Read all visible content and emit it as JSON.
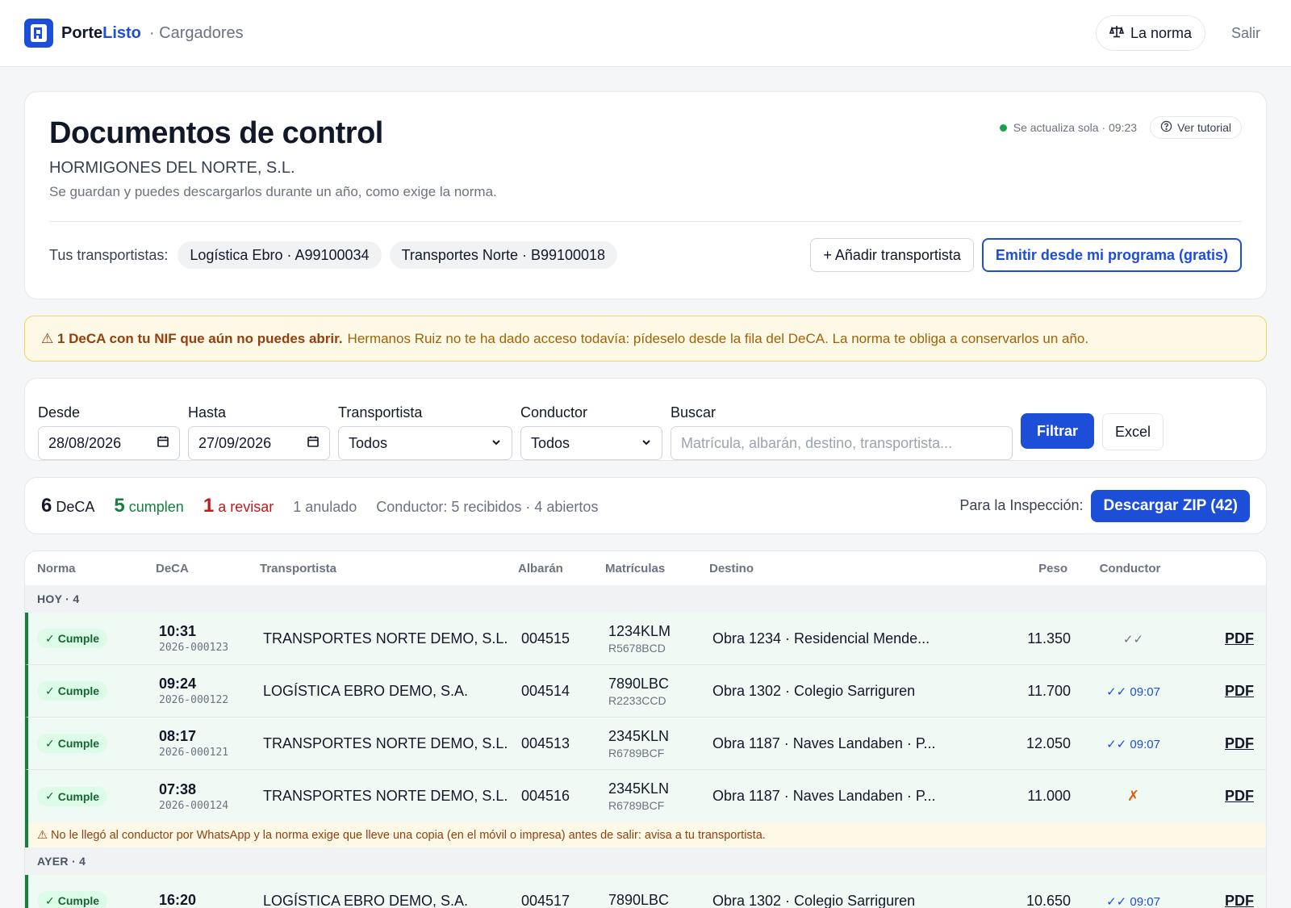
{
  "app": {
    "brand_part1": "Porte",
    "brand_part2": "Listo",
    "brand_sub": "· Cargadores",
    "norma_label": "La norma",
    "logout_label": "Salir"
  },
  "header": {
    "title": "Documentos de control",
    "company": "HORMIGONES DEL NORTE, S.L.",
    "note": "Se guardan y puedes descargarlos durante un año, como exige la norma.",
    "live_status": "Se actualiza sola · 09:23",
    "tutorial_label": "Ver tutorial",
    "carriers_label": "Tus transportistas:",
    "carriers": [
      "Logística Ebro · A99100034",
      "Transportes Norte · B99100018"
    ],
    "add_carrier_label": "+ Añadir transportista",
    "emit_label": "Emitir desde mi programa (gratis)"
  },
  "alert": {
    "strong": "⚠ 1 DeCA con tu NIF que aún no puedes abrir.",
    "rest": "Hermanos Ruiz no te ha dado acceso todavía: pídeselo desde la fila del DeCA. La norma te obliga a conservarlos un año."
  },
  "filters": {
    "desde_label": "Desde",
    "desde_value": "28/08/2026",
    "hasta_label": "Hasta",
    "hasta_value": "27/09/2026",
    "transportista_label": "Transportista",
    "transportista_value": "Todos",
    "conductor_label": "Conductor",
    "conductor_value": "Todos",
    "buscar_label": "Buscar",
    "buscar_placeholder": "Matrícula, albarán, destino, transportista...",
    "filter_button": "Filtrar",
    "excel_button": "Excel"
  },
  "summary": {
    "total_num": "6",
    "total_label": "DeCA",
    "ok_num": "5",
    "ok_label": "cumplen",
    "review_num": "1",
    "review_label": "a revisar",
    "annulled": "1 anulado",
    "driver_status": "Conductor: 5 recibidos · 4 abiertos",
    "inspection_label": "Para la Inspección:",
    "zip_button": "Descargar ZIP (42)"
  },
  "table": {
    "headers": {
      "norma": "Norma",
      "deca": "DeCA",
      "transportista": "Transportista",
      "albaran": "Albarán",
      "matriculas": "Matrículas",
      "destino": "Destino",
      "peso": "Peso",
      "conductor": "Conductor"
    },
    "group_today": "HOY · 4",
    "group_yesterday": "AYER · 4",
    "rows": [
      {
        "status": "Cumple",
        "time": "10:31",
        "deca": "2026-000123",
        "transportista": "TRANSPORTES NORTE DEMO, S.L.",
        "albaran": "004515",
        "mat1": "1234KLM",
        "mat2": "R5678BCD",
        "destino": "Obra 1234 · Residencial Mende...",
        "peso": "11.350",
        "conductor": "✓✓",
        "pdf": "PDF"
      },
      {
        "status": "Cumple",
        "time": "09:24",
        "deca": "2026-000122",
        "transportista": "LOGÍSTICA EBRO DEMO, S.A.",
        "albaran": "004514",
        "mat1": "7890LBC",
        "mat2": "R2233CCD",
        "destino": "Obra 1302 · Colegio Sarriguren",
        "peso": "11.700",
        "conductor": "✓✓ 09:07",
        "pdf": "PDF"
      },
      {
        "status": "Cumple",
        "time": "08:17",
        "deca": "2026-000121",
        "transportista": "TRANSPORTES NORTE DEMO, S.L.",
        "albaran": "004513",
        "mat1": "2345KLN",
        "mat2": "R6789BCF",
        "destino": "Obra 1187 · Naves Landaben · P...",
        "peso": "12.050",
        "conductor": "✓✓ 09:07",
        "pdf": "PDF"
      },
      {
        "status": "Cumple",
        "time": "07:38",
        "deca": "2026-000124",
        "transportista": "TRANSPORTES NORTE DEMO, S.L.",
        "albaran": "004516",
        "mat1": "2345KLN",
        "mat2": "R6789BCF",
        "destino": "Obra 1187 · Naves Landaben · P...",
        "peso": "11.000",
        "conductor": "✗",
        "pdf": "PDF"
      },
      {
        "status": "Cumple",
        "time": "16:20",
        "deca": "",
        "transportista": "LOGÍSTICA EBRO DEMO, S.A.",
        "albaran": "004517",
        "mat1": "7890LBC",
        "mat2": "",
        "destino": "Obra 1302 · Colegio Sarriguren",
        "peso": "10.650",
        "conductor": "✓✓ 09:07",
        "pdf": "PDF"
      }
    ],
    "warning": "⚠ No le llegó al conductor por WhatsApp y la norma exige que lleve una copia (en el móvil o impresa) antes de salir: avisa a tu transportista."
  },
  "colors": {
    "primary": "#1d4ed8",
    "ok": "#15803d",
    "danger": "#b91c1c",
    "warning_bg": "#fef9e7"
  }
}
